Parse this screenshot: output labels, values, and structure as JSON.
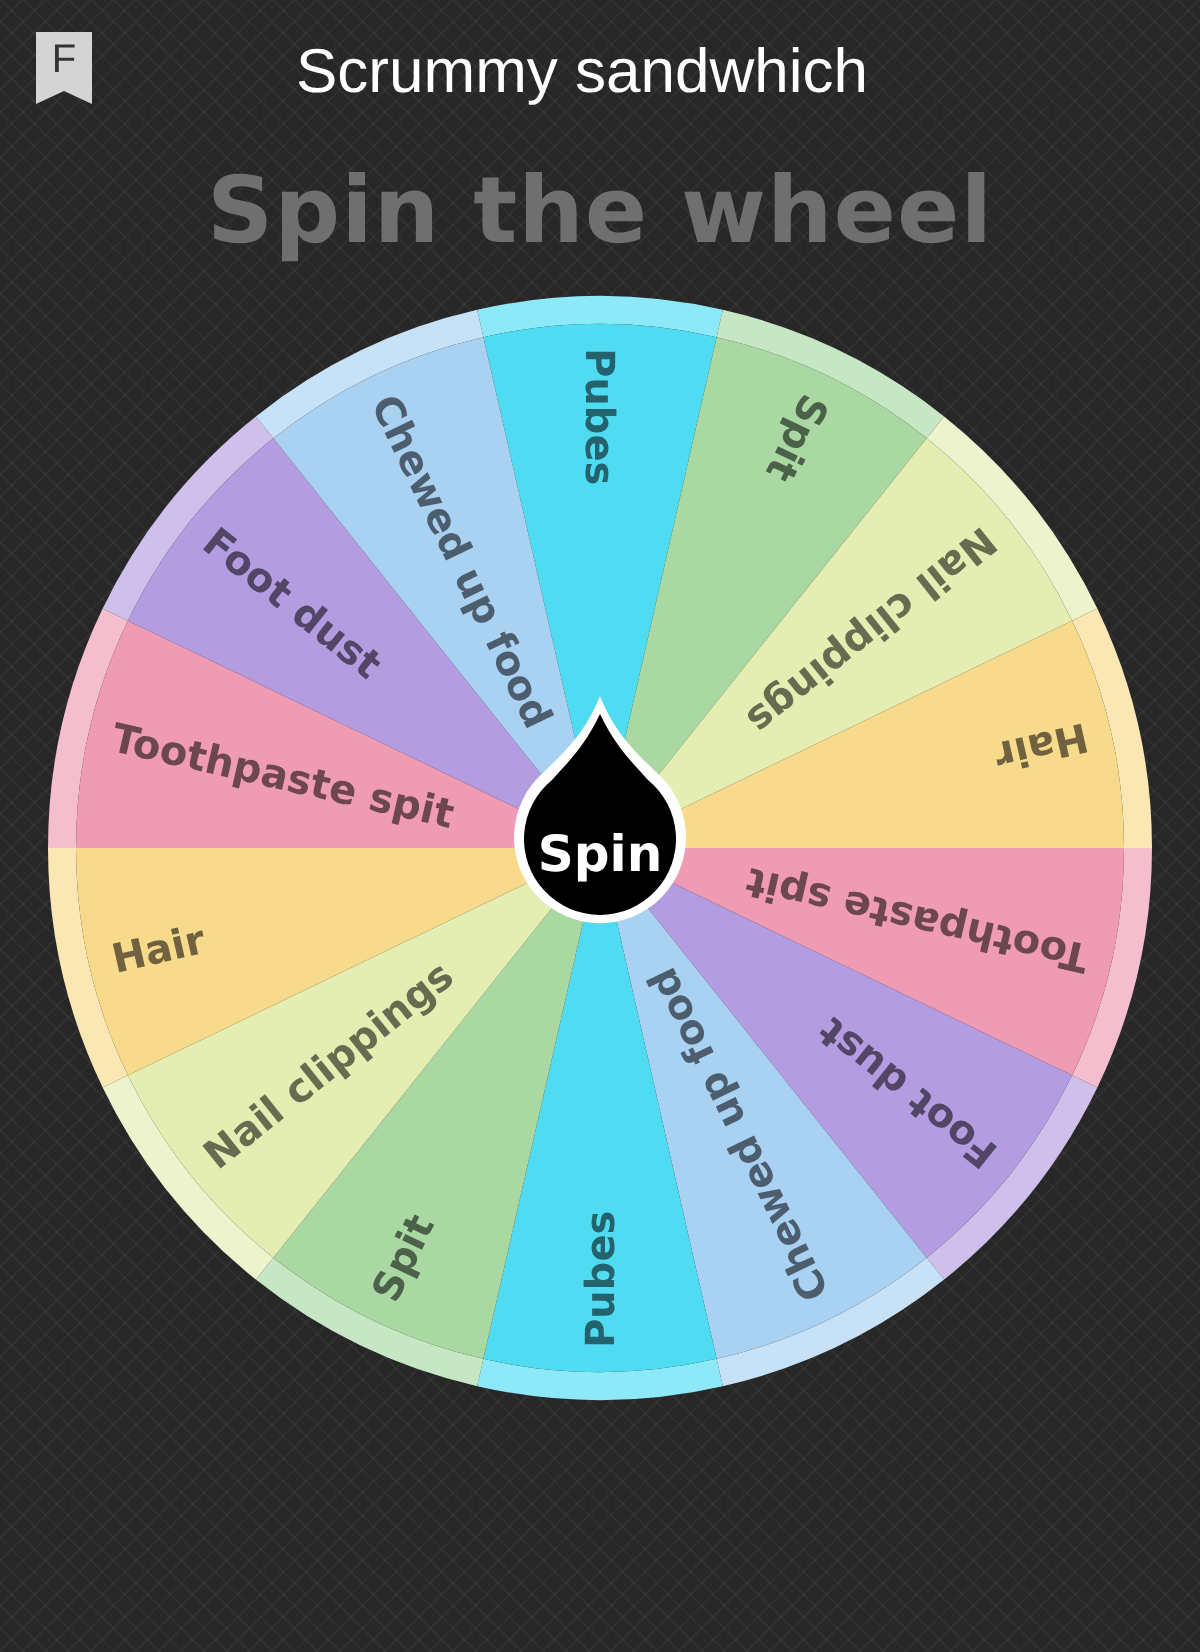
{
  "header": {
    "badge": "F",
    "title": "Scrummy sandwhich"
  },
  "heading": "Spin the wheel",
  "wheel": {
    "segments": [
      {
        "label": "Pubes",
        "color": "#4fdcf2"
      },
      {
        "label": "Spit",
        "color": "#a9d8a2"
      },
      {
        "label": "Nail clippings",
        "color": "#e4edb2"
      },
      {
        "label": "Hair",
        "color": "#f8da8c"
      },
      {
        "label": "Toothpaste spit",
        "color": "#ef9bb3"
      },
      {
        "label": "Foot dust",
        "color": "#b39ce0"
      },
      {
        "label": "Chewed up food",
        "color": "#a9d1f2"
      },
      {
        "label": "Pubes",
        "color": "#4fdcf2"
      },
      {
        "label": "Spit",
        "color": "#a9d8a2"
      },
      {
        "label": "Nail clippings",
        "color": "#e4edb2"
      },
      {
        "label": "Hair",
        "color": "#f8da8c"
      },
      {
        "label": "Toothpaste spit",
        "color": "#ef9bb3"
      },
      {
        "label": "Foot dust",
        "color": "#b39ce0"
      },
      {
        "label": "Chewed up food",
        "color": "#a9d1f2"
      }
    ],
    "spin_button": "Spin"
  }
}
